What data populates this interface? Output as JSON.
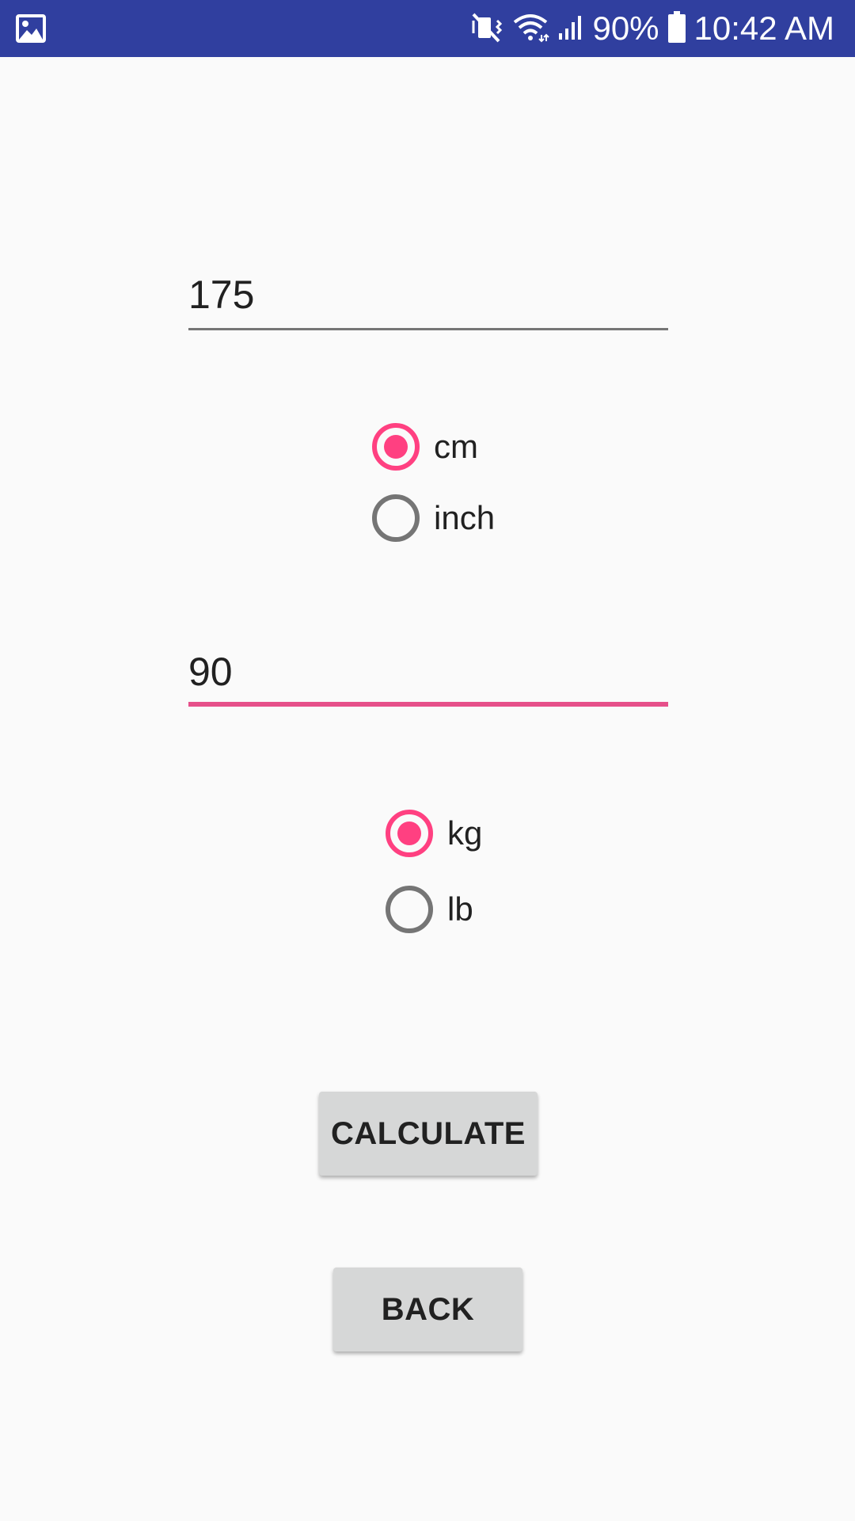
{
  "status_bar": {
    "battery": "90%",
    "time": "10:42 AM",
    "icons": [
      "image-icon",
      "vibrate-mute-icon",
      "wifi-icon",
      "signal-icon",
      "battery-icon"
    ],
    "background": "#303f9f"
  },
  "height": {
    "value": "175",
    "units": [
      {
        "label": "cm",
        "checked": true
      },
      {
        "label": "inch",
        "checked": false
      }
    ]
  },
  "weight": {
    "value": "90",
    "focused": true,
    "units": [
      {
        "label": "kg",
        "checked": true
      },
      {
        "label": "lb",
        "checked": false
      }
    ]
  },
  "buttons": {
    "calculate": "CALCULATE",
    "back": "BACK"
  },
  "colors": {
    "accent": "#ff4081",
    "primary_dark": "#303f9f",
    "button_bg": "#d6d7d7"
  }
}
